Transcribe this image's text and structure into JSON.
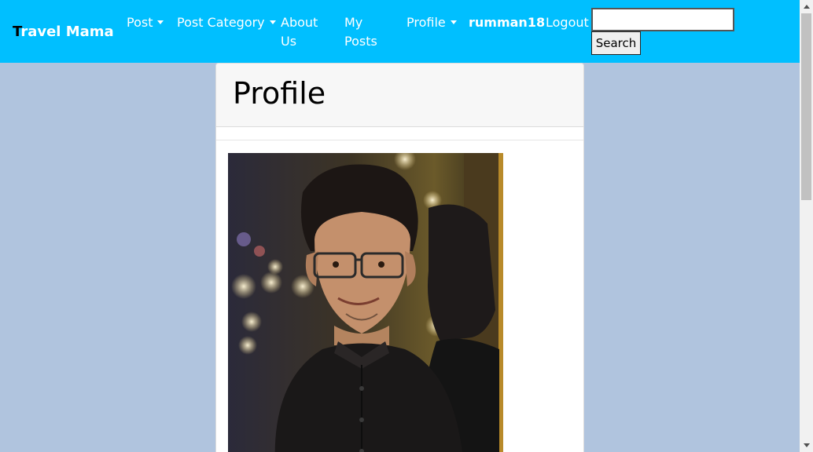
{
  "navbar": {
    "brand_first": "T",
    "brand_rest": "ravel Mama",
    "post": "Post",
    "post_category": "Post Category",
    "about_line1": "About",
    "about_line2": "Us",
    "my_posts_line1": "My",
    "my_posts_line2": "Posts",
    "profile": "Profile",
    "username": "rumman18",
    "logout": "Logout",
    "search_value": "",
    "search_button": "Search"
  },
  "card": {
    "title": "Profile",
    "photo_alt": "profile-photo"
  },
  "colors": {
    "navbar_bg": "#00bfff",
    "page_bg": "#b0c4de"
  }
}
